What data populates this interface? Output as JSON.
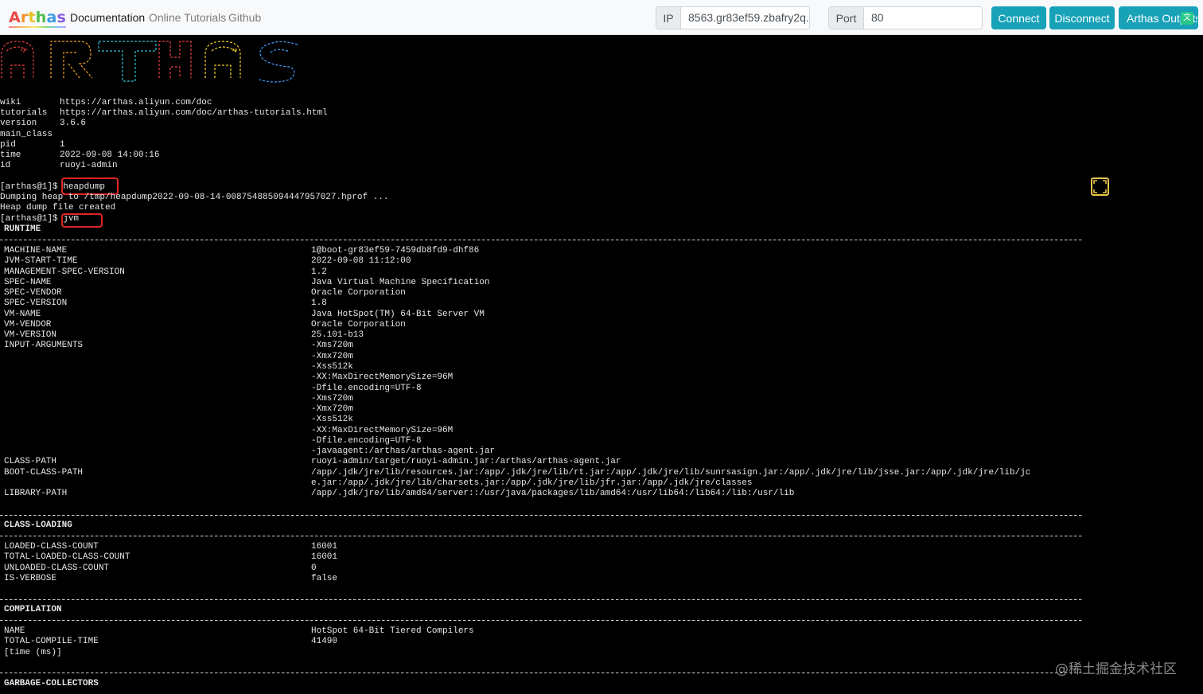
{
  "navbar": {
    "brand": "Arthas",
    "links": {
      "documentation": "Documentation",
      "tutorials": "Online Tutorials",
      "github": "Github"
    },
    "ip_label": "IP",
    "ip_value": "8563.gr83ef59.zbafry2q.",
    "port_label": "Port",
    "port_value": "80",
    "connect": "Connect",
    "disconnect": "Disconnect",
    "outputs": "Arthas Outputs"
  },
  "terminal": {
    "info": [
      {
        "key": "wiki",
        "value": "https://arthas.aliyun.com/doc"
      },
      {
        "key": "tutorials",
        "value": "https://arthas.aliyun.com/doc/arthas-tutorials.html"
      },
      {
        "key": "version",
        "value": "3.6.6"
      },
      {
        "key": "main_class",
        "value": ""
      },
      {
        "key": "pid",
        "value": "1"
      },
      {
        "key": "time",
        "value": "2022-09-08 14:00:16"
      },
      {
        "key": "id",
        "value": "ruoyi-admin"
      }
    ],
    "prompt": "[arthas@1]$ ",
    "cmd_heapdump": "heapdump",
    "heapdump_out1": "Dumping heap to /tmp/heapdump2022-09-08-14-008754885094447957027.hprof ...",
    "heapdump_out2": "Heap dump file created",
    "cmd_jvm": "jvm",
    "runtime": {
      "title": "RUNTIME",
      "rows": [
        {
          "key": "MACHINE-NAME",
          "value": "1@boot-gr83ef59-7459db8fd9-dhf86"
        },
        {
          "key": "JVM-START-TIME",
          "value": "2022-09-08 11:12:00"
        },
        {
          "key": "MANAGEMENT-SPEC-VERSION",
          "value": "1.2"
        },
        {
          "key": "SPEC-NAME",
          "value": "Java Virtual Machine Specification"
        },
        {
          "key": "SPEC-VENDOR",
          "value": "Oracle Corporation"
        },
        {
          "key": "SPEC-VERSION",
          "value": "1.8"
        },
        {
          "key": "VM-NAME",
          "value": "Java HotSpot(TM) 64-Bit Server VM"
        },
        {
          "key": "VM-VENDOR",
          "value": "Oracle Corporation"
        },
        {
          "key": "VM-VERSION",
          "value": "25.101-b13"
        },
        {
          "key": "INPUT-ARGUMENTS",
          "value": "-Xms720m"
        },
        {
          "key": "",
          "value": "-Xmx720m"
        },
        {
          "key": "",
          "value": "-Xss512k"
        },
        {
          "key": "",
          "value": "-XX:MaxDirectMemorySize=96M"
        },
        {
          "key": "",
          "value": "-Dfile.encoding=UTF-8"
        },
        {
          "key": "",
          "value": "-Xms720m"
        },
        {
          "key": "",
          "value": "-Xmx720m"
        },
        {
          "key": "",
          "value": "-Xss512k"
        },
        {
          "key": "",
          "value": "-XX:MaxDirectMemorySize=96M"
        },
        {
          "key": "",
          "value": "-Dfile.encoding=UTF-8"
        },
        {
          "key": "",
          "value": "-javaagent:/arthas/arthas-agent.jar"
        },
        {
          "key": "CLASS-PATH",
          "value": "ruoyi-admin/target/ruoyi-admin.jar:/arthas/arthas-agent.jar"
        },
        {
          "key": "BOOT-CLASS-PATH",
          "value": "/app/.jdk/jre/lib/resources.jar:/app/.jdk/jre/lib/rt.jar:/app/.jdk/jre/lib/sunrsasign.jar:/app/.jdk/jre/lib/jsse.jar:/app/.jdk/jre/lib/jc"
        },
        {
          "key": "",
          "value": "e.jar:/app/.jdk/jre/lib/charsets.jar:/app/.jdk/jre/lib/jfr.jar:/app/.jdk/jre/classes"
        },
        {
          "key": "LIBRARY-PATH",
          "value": "/app/.jdk/jre/lib/amd64/server::/usr/java/packages/lib/amd64:/usr/lib64:/lib64:/lib:/usr/lib"
        }
      ]
    },
    "class_loading": {
      "title": "CLASS-LOADING",
      "rows": [
        {
          "key": "LOADED-CLASS-COUNT",
          "value": "16001"
        },
        {
          "key": "TOTAL-LOADED-CLASS-COUNT",
          "value": "16001"
        },
        {
          "key": "UNLOADED-CLASS-COUNT",
          "value": "0"
        },
        {
          "key": "IS-VERBOSE",
          "value": "false"
        }
      ]
    },
    "compilation": {
      "title": "COMPILATION",
      "rows": [
        {
          "key": "NAME",
          "value": "HotSpot 64-Bit Tiered Compilers"
        },
        {
          "key": "TOTAL-COMPILE-TIME",
          "value": "41490"
        },
        {
          "key": "[time (ms)]",
          "value": ""
        }
      ]
    },
    "gc": {
      "title": "GARBAGE-COLLECTORS"
    }
  },
  "watermark": "@稀土掘金技术社区",
  "colors": {
    "button": "#17a2b8",
    "highlight": "#e02424",
    "fullscreen_icon": "#e8c548"
  }
}
